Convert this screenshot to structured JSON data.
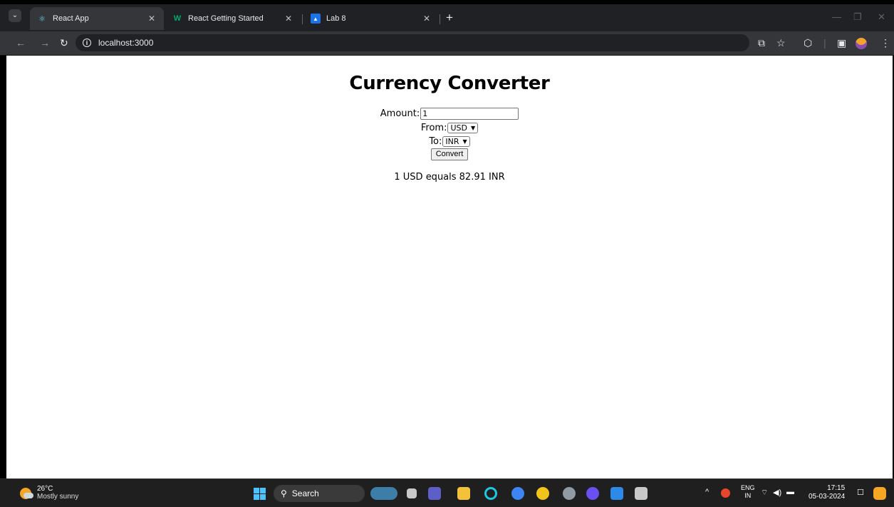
{
  "browser": {
    "tabs": [
      {
        "title": "React App",
        "icon": "react-icon"
      },
      {
        "title": "React Getting Started",
        "icon": "w3schools-icon"
      },
      {
        "title": "Lab 8",
        "icon": "classroom-icon"
      }
    ],
    "url": "localhost:3000"
  },
  "app": {
    "heading": "Currency Converter",
    "amount_label": "Amount:",
    "amount_value": "1",
    "from_label": "From:",
    "from_value": "USD",
    "to_label": "To:",
    "to_value": "INR",
    "convert_label": "Convert",
    "result": "1 USD equals 82.91 INR"
  },
  "taskbar": {
    "temperature": "26°C",
    "weather": "Mostly sunny",
    "search_label": "Search",
    "lang_top": "ENG",
    "lang_bottom": "IN",
    "time": "17:15",
    "date": "05-03-2024"
  },
  "colors": {
    "chrome_dark": "#202124",
    "toolbar": "#35363a",
    "taskbar": "#1f1f1f",
    "windows_accent": "#4cc2ff"
  }
}
